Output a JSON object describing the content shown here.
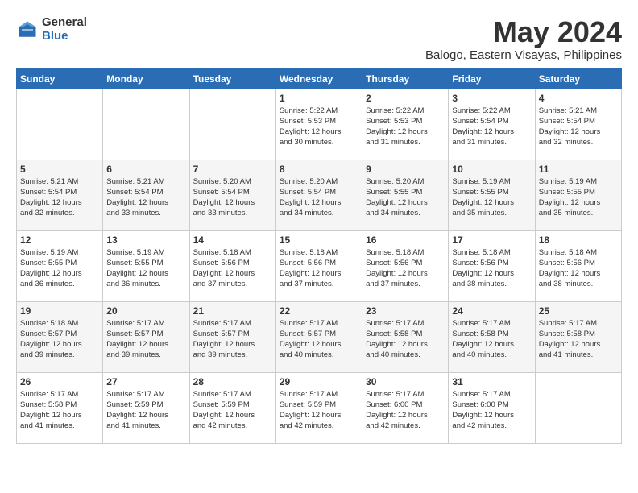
{
  "header": {
    "logo_general": "General",
    "logo_blue": "Blue",
    "month": "May 2024",
    "location": "Balogo, Eastern Visayas, Philippines"
  },
  "days_of_week": [
    "Sunday",
    "Monday",
    "Tuesday",
    "Wednesday",
    "Thursday",
    "Friday",
    "Saturday"
  ],
  "weeks": [
    [
      {
        "day": "",
        "info": ""
      },
      {
        "day": "",
        "info": ""
      },
      {
        "day": "",
        "info": ""
      },
      {
        "day": "1",
        "info": "Sunrise: 5:22 AM\nSunset: 5:53 PM\nDaylight: 12 hours\nand 30 minutes."
      },
      {
        "day": "2",
        "info": "Sunrise: 5:22 AM\nSunset: 5:53 PM\nDaylight: 12 hours\nand 31 minutes."
      },
      {
        "day": "3",
        "info": "Sunrise: 5:22 AM\nSunset: 5:54 PM\nDaylight: 12 hours\nand 31 minutes."
      },
      {
        "day": "4",
        "info": "Sunrise: 5:21 AM\nSunset: 5:54 PM\nDaylight: 12 hours\nand 32 minutes."
      }
    ],
    [
      {
        "day": "5",
        "info": "Sunrise: 5:21 AM\nSunset: 5:54 PM\nDaylight: 12 hours\nand 32 minutes."
      },
      {
        "day": "6",
        "info": "Sunrise: 5:21 AM\nSunset: 5:54 PM\nDaylight: 12 hours\nand 33 minutes."
      },
      {
        "day": "7",
        "info": "Sunrise: 5:20 AM\nSunset: 5:54 PM\nDaylight: 12 hours\nand 33 minutes."
      },
      {
        "day": "8",
        "info": "Sunrise: 5:20 AM\nSunset: 5:54 PM\nDaylight: 12 hours\nand 34 minutes."
      },
      {
        "day": "9",
        "info": "Sunrise: 5:20 AM\nSunset: 5:55 PM\nDaylight: 12 hours\nand 34 minutes."
      },
      {
        "day": "10",
        "info": "Sunrise: 5:19 AM\nSunset: 5:55 PM\nDaylight: 12 hours\nand 35 minutes."
      },
      {
        "day": "11",
        "info": "Sunrise: 5:19 AM\nSunset: 5:55 PM\nDaylight: 12 hours\nand 35 minutes."
      }
    ],
    [
      {
        "day": "12",
        "info": "Sunrise: 5:19 AM\nSunset: 5:55 PM\nDaylight: 12 hours\nand 36 minutes."
      },
      {
        "day": "13",
        "info": "Sunrise: 5:19 AM\nSunset: 5:55 PM\nDaylight: 12 hours\nand 36 minutes."
      },
      {
        "day": "14",
        "info": "Sunrise: 5:18 AM\nSunset: 5:56 PM\nDaylight: 12 hours\nand 37 minutes."
      },
      {
        "day": "15",
        "info": "Sunrise: 5:18 AM\nSunset: 5:56 PM\nDaylight: 12 hours\nand 37 minutes."
      },
      {
        "day": "16",
        "info": "Sunrise: 5:18 AM\nSunset: 5:56 PM\nDaylight: 12 hours\nand 37 minutes."
      },
      {
        "day": "17",
        "info": "Sunrise: 5:18 AM\nSunset: 5:56 PM\nDaylight: 12 hours\nand 38 minutes."
      },
      {
        "day": "18",
        "info": "Sunrise: 5:18 AM\nSunset: 5:56 PM\nDaylight: 12 hours\nand 38 minutes."
      }
    ],
    [
      {
        "day": "19",
        "info": "Sunrise: 5:18 AM\nSunset: 5:57 PM\nDaylight: 12 hours\nand 39 minutes."
      },
      {
        "day": "20",
        "info": "Sunrise: 5:17 AM\nSunset: 5:57 PM\nDaylight: 12 hours\nand 39 minutes."
      },
      {
        "day": "21",
        "info": "Sunrise: 5:17 AM\nSunset: 5:57 PM\nDaylight: 12 hours\nand 39 minutes."
      },
      {
        "day": "22",
        "info": "Sunrise: 5:17 AM\nSunset: 5:57 PM\nDaylight: 12 hours\nand 40 minutes."
      },
      {
        "day": "23",
        "info": "Sunrise: 5:17 AM\nSunset: 5:58 PM\nDaylight: 12 hours\nand 40 minutes."
      },
      {
        "day": "24",
        "info": "Sunrise: 5:17 AM\nSunset: 5:58 PM\nDaylight: 12 hours\nand 40 minutes."
      },
      {
        "day": "25",
        "info": "Sunrise: 5:17 AM\nSunset: 5:58 PM\nDaylight: 12 hours\nand 41 minutes."
      }
    ],
    [
      {
        "day": "26",
        "info": "Sunrise: 5:17 AM\nSunset: 5:58 PM\nDaylight: 12 hours\nand 41 minutes."
      },
      {
        "day": "27",
        "info": "Sunrise: 5:17 AM\nSunset: 5:59 PM\nDaylight: 12 hours\nand 41 minutes."
      },
      {
        "day": "28",
        "info": "Sunrise: 5:17 AM\nSunset: 5:59 PM\nDaylight: 12 hours\nand 42 minutes."
      },
      {
        "day": "29",
        "info": "Sunrise: 5:17 AM\nSunset: 5:59 PM\nDaylight: 12 hours\nand 42 minutes."
      },
      {
        "day": "30",
        "info": "Sunrise: 5:17 AM\nSunset: 6:00 PM\nDaylight: 12 hours\nand 42 minutes."
      },
      {
        "day": "31",
        "info": "Sunrise: 5:17 AM\nSunset: 6:00 PM\nDaylight: 12 hours\nand 42 minutes."
      },
      {
        "day": "",
        "info": ""
      }
    ]
  ]
}
